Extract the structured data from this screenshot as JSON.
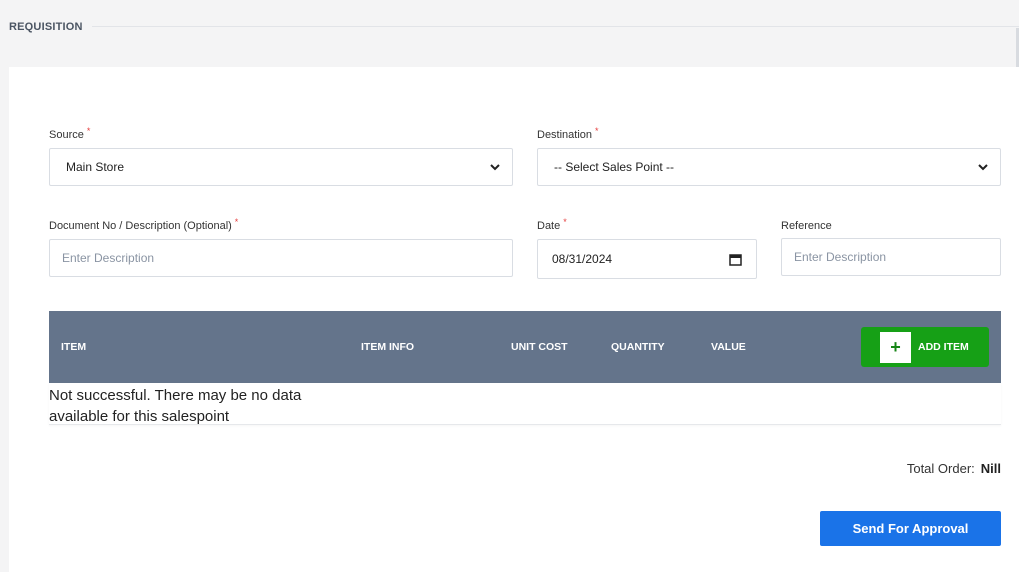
{
  "header": {
    "title": "REQUISITION"
  },
  "form": {
    "source": {
      "label": "Source",
      "value": "Main Store"
    },
    "destination": {
      "label": "Destination",
      "value": "-- Select Sales Point --"
    },
    "document": {
      "label": "Document No / Description (Optional)",
      "placeholder": "Enter Description"
    },
    "date": {
      "label": "Date",
      "value": "08/31/2024"
    },
    "reference": {
      "label": "Reference",
      "placeholder": "Enter Description"
    },
    "required_mark": "*"
  },
  "table": {
    "columns": [
      "ITEM",
      "ITEM INFO",
      "UNIT COST",
      "QUANTITY",
      "VALUE"
    ],
    "add_button": {
      "icon": "+",
      "label": "ADD ITEM"
    },
    "empty_message": "Not successful. There may be no data available for this salespoint"
  },
  "summary": {
    "total_label": "Total Order:",
    "total_value": "Nill"
  },
  "actions": {
    "send_label": "Send For Approval"
  },
  "colors": {
    "table_header": "#64748b",
    "add_button": "#16a016",
    "primary": "#1a73e8",
    "required": "#e53e3e"
  }
}
